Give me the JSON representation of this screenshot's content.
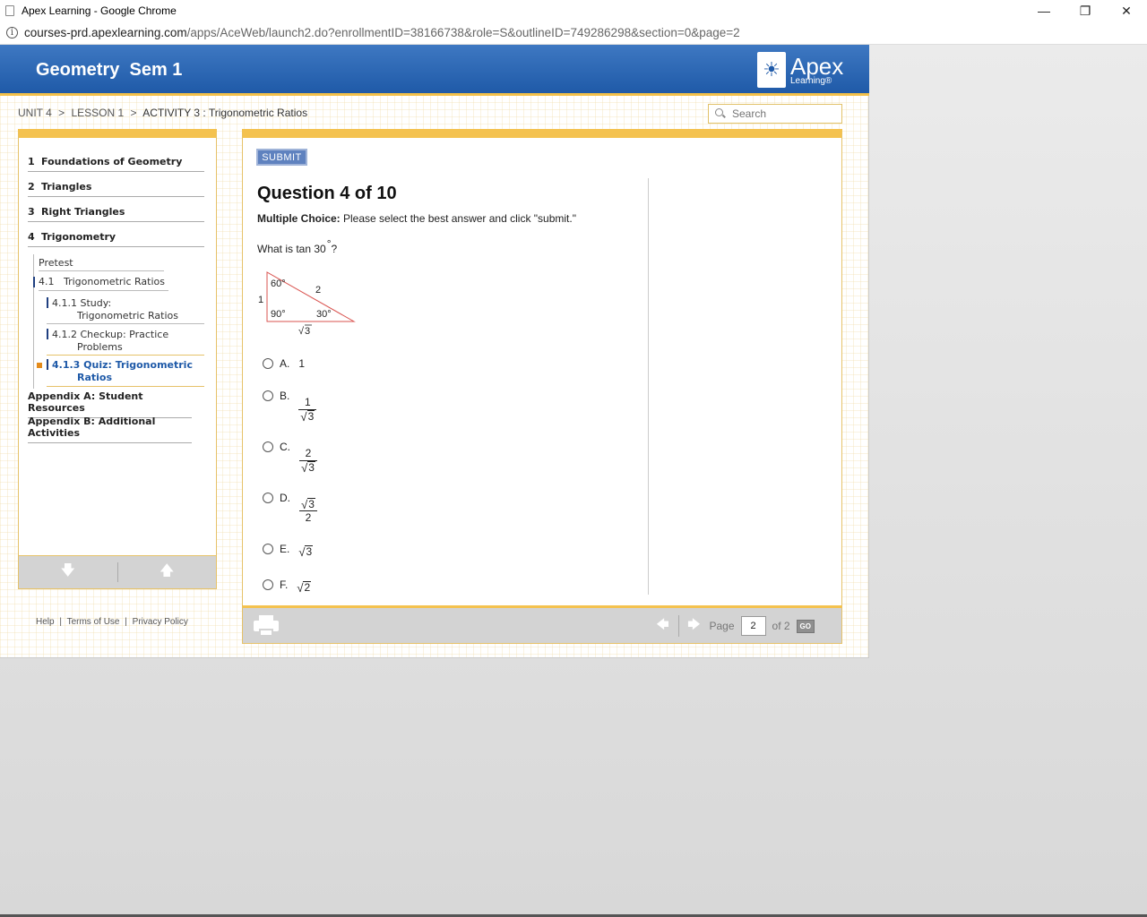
{
  "window": {
    "title": "Apex Learning - Google Chrome",
    "minimize": "—",
    "restore": "❐",
    "close": "✕"
  },
  "address": {
    "host": "courses-prd.apexlearning.com",
    "path": "/apps/AceWeb/launch2.do?enrollmentID=38166738&role=S&outlineID=749286298&section=0&page=2"
  },
  "header": {
    "course_title": "Geometry  Sem 1",
    "logo_big": "Apex",
    "logo_small": "Learning®"
  },
  "breadcrumb": {
    "unit": "UNIT 4",
    "lesson": "LESSON 1",
    "activity": "ACTIVITY 3 : Trigonometric Ratios",
    "sep": ">"
  },
  "search": {
    "placeholder": "Search"
  },
  "sidebar": {
    "units": [
      {
        "num": "1",
        "label": "Foundations of Geometry"
      },
      {
        "num": "2",
        "label": "Triangles"
      },
      {
        "num": "3",
        "label": "Right Triangles"
      },
      {
        "num": "4",
        "label": "Trigonometry"
      }
    ],
    "pretest": "Pretest",
    "lesson": {
      "num": "4.1",
      "label": "Trigonometric Ratios"
    },
    "activities": [
      {
        "num": "4.1.1",
        "line1": "Study:",
        "line2": "Trigonometric Ratios"
      },
      {
        "num": "4.1.2",
        "line1": "Checkup: Practice",
        "line2": "Problems"
      },
      {
        "num": "4.1.3",
        "line1": "Quiz: Trigonometric",
        "line2": "Ratios"
      }
    ],
    "appendices": [
      "Appendix A: Student Resources",
      "Appendix B: Additional Activities"
    ],
    "down_arrow": "🡇",
    "up_arrow": "🡅"
  },
  "footer_links": {
    "help": "Help",
    "terms": "Terms of Use",
    "privacy": "Privacy Policy",
    "sep": "|"
  },
  "question": {
    "submit_label": "SUBMIT",
    "title": "Question 4 of 10",
    "instr_bold": "Multiple Choice:",
    "instr_rest": " Please select the best answer and click \"submit.\"",
    "text_pre": "What is tan 30",
    "text_deg": "°",
    "text_post": "?",
    "triangle": {
      "angle_top": "60°",
      "hyp": "2",
      "left_side": "1",
      "angle_right_corner": "90°",
      "angle_bottom": "30°",
      "bottom_side": "3"
    },
    "choices": {
      "A": {
        "letter": "A.",
        "value": "1"
      },
      "B": {
        "letter": "B.",
        "num": "1",
        "den": "3"
      },
      "C": {
        "letter": "C.",
        "num": "2",
        "den": "3"
      },
      "D": {
        "letter": "D.",
        "num": "3",
        "den": "2"
      },
      "E": {
        "letter": "E.",
        "value": "3"
      },
      "F": {
        "letter": "F.",
        "value": "2"
      }
    }
  },
  "pager": {
    "prev": "🡄",
    "next": "🡆",
    "page_label": "Page",
    "page_value": "2",
    "of_label": "of 2",
    "go_label": "GO"
  },
  "colors": {
    "header_blue": "#1f5aa8",
    "accent_yellow": "#f4c24f",
    "active_orange": "#e48b1b"
  }
}
